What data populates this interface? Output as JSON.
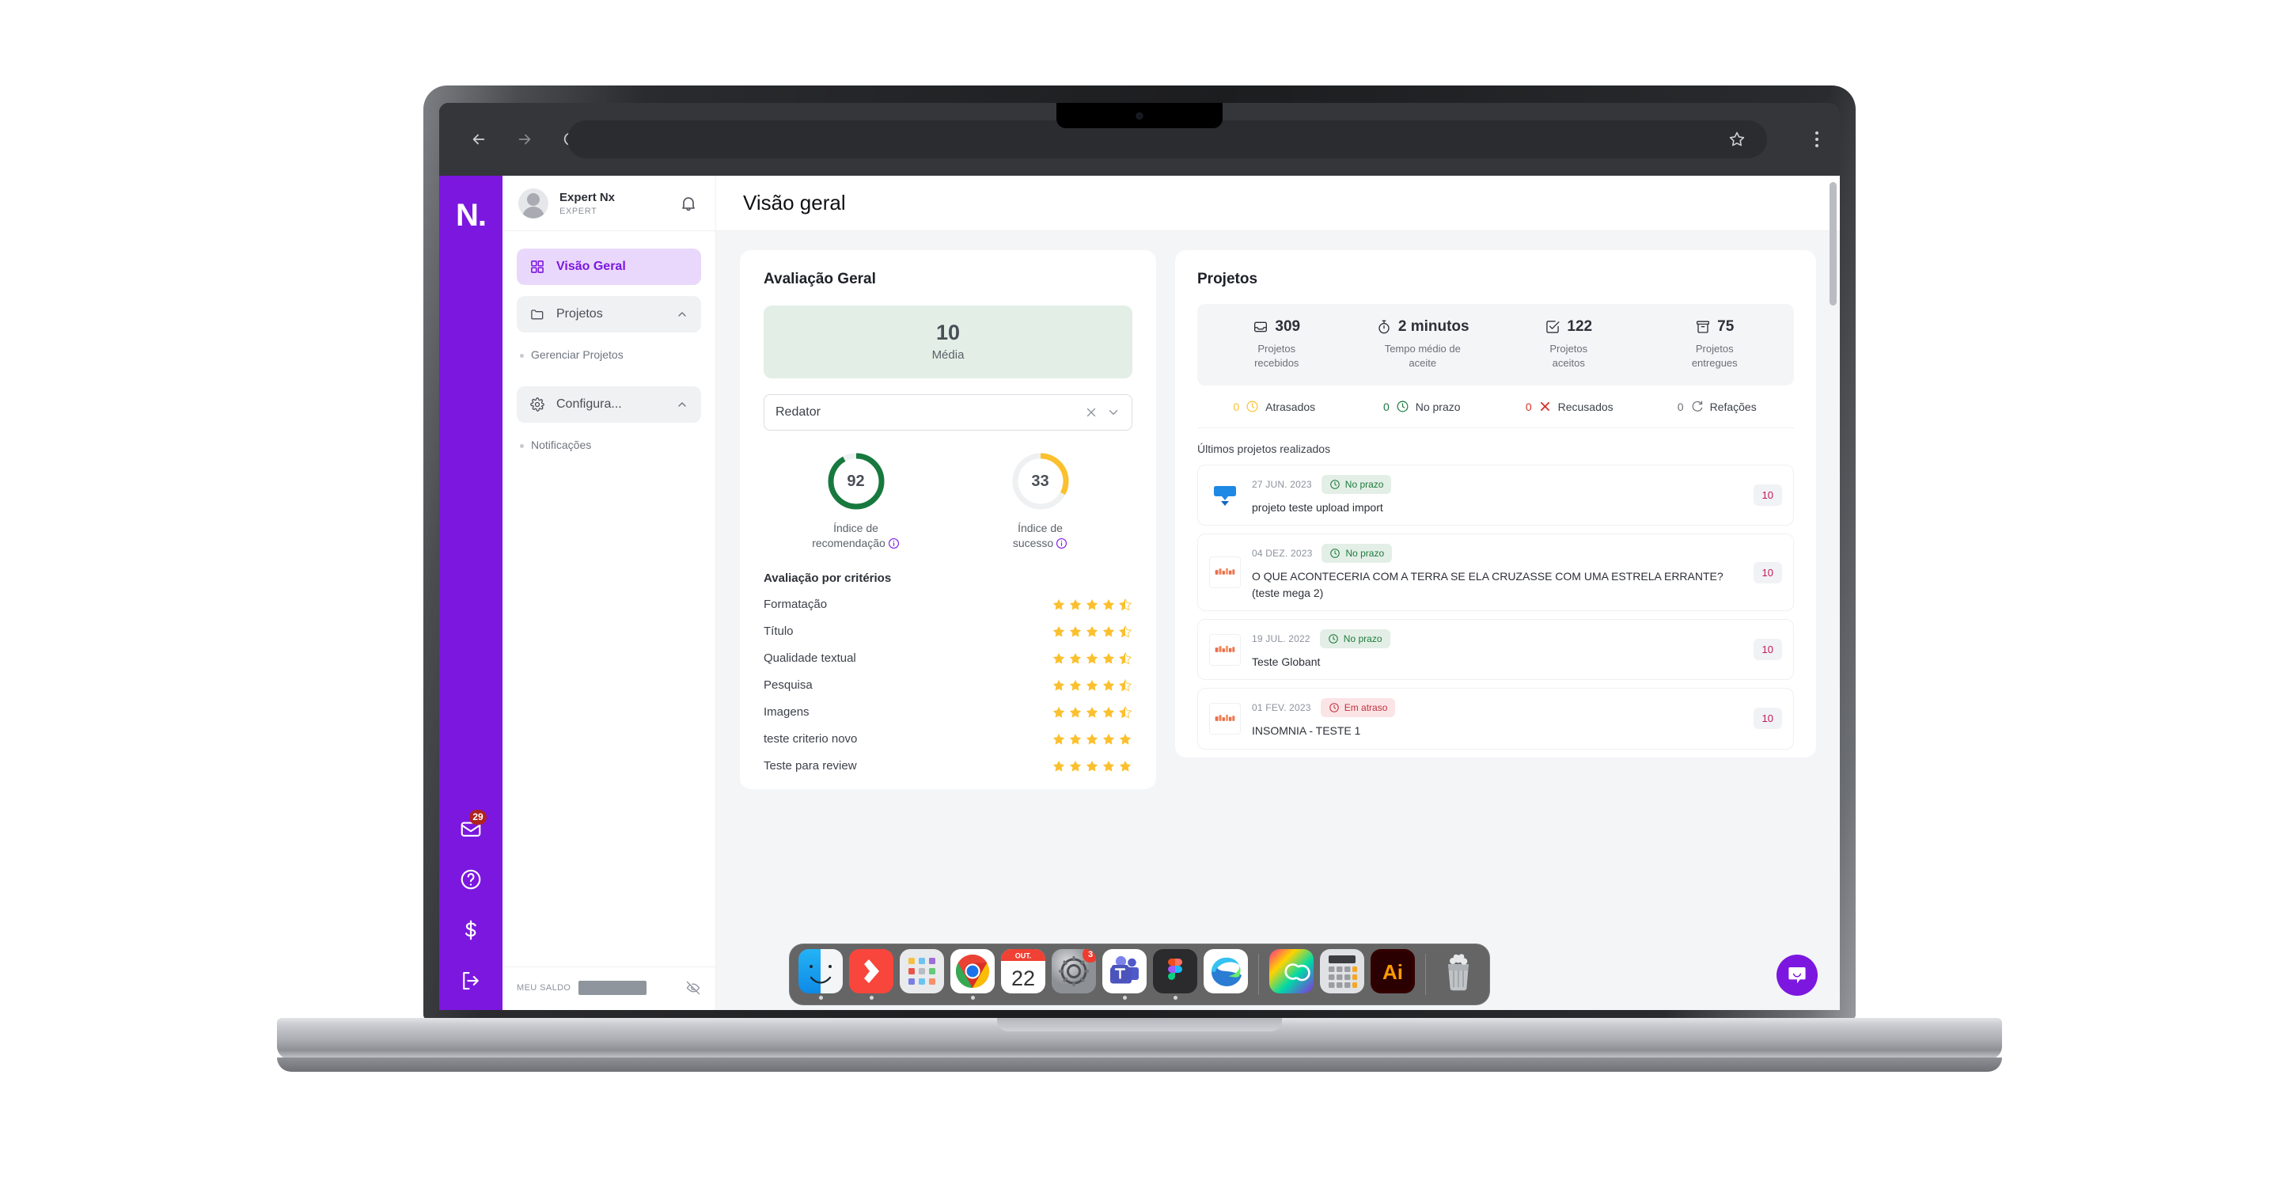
{
  "browser": {
    "back_icon": "arrow-left-icon",
    "forward_icon": "arrow-right-icon",
    "reload_icon": "reload-icon",
    "url_value": "",
    "url_placeholder": "",
    "bookmark_icon": "star-icon",
    "menu_icon": "kebab-menu-icon"
  },
  "rail": {
    "logo": "N.",
    "icons": [
      {
        "name": "mail-icon",
        "badge": "29"
      },
      {
        "name": "help-icon",
        "badge": ""
      },
      {
        "name": "dollar-icon",
        "badge": ""
      },
      {
        "name": "logout-icon",
        "badge": ""
      }
    ]
  },
  "sidebar": {
    "user": {
      "name": "Expert Nx",
      "role": "EXPERT"
    },
    "bell_icon": "bell-icon",
    "items": [
      {
        "label": "Visão Geral",
        "icon": "grid-icon",
        "type": "active"
      },
      {
        "label": "Projetos",
        "icon": "folder-icon",
        "type": "group"
      },
      {
        "label": "Gerenciar Projetos",
        "icon": "",
        "type": "sub"
      },
      {
        "label": "Configura...",
        "icon": "gear-icon",
        "type": "group"
      },
      {
        "label": "Notificações",
        "icon": "",
        "type": "sub"
      }
    ],
    "balance": {
      "label": "MEU SALDO",
      "value": "",
      "toggle_icon": "eye-off-icon"
    }
  },
  "header": {
    "title": "Visão geral"
  },
  "evaluation": {
    "card_title": "Avaliação Geral",
    "average_value": "10",
    "average_label": "Média",
    "role_select": {
      "value": "Redator",
      "clear_icon": "close-icon",
      "chevron_icon": "chevron-down-icon"
    },
    "gauges": [
      {
        "value": "92",
        "label_line1": "Índice de",
        "label_line2": "recomendação",
        "color": "#17793E",
        "track": "#eef0f2",
        "percent": 92
      },
      {
        "value": "33",
        "label_line1": "Índice de",
        "label_line2": "sucesso",
        "color": "#FBC02D",
        "track": "#eef0f2",
        "percent": 33
      }
    ],
    "criteria_title": "Avaliação por critérios",
    "criteria": [
      {
        "name": "Formatação",
        "rating": 4.5
      },
      {
        "name": "Título",
        "rating": 4.5
      },
      {
        "name": "Qualidade textual",
        "rating": 4.5
      },
      {
        "name": "Pesquisa",
        "rating": 4.5
      },
      {
        "name": "Imagens",
        "rating": 4.5
      },
      {
        "name": "teste criterio novo",
        "rating": 5
      },
      {
        "name": "Teste para review",
        "rating": 5
      }
    ]
  },
  "projects": {
    "card_title": "Projetos",
    "stats": [
      {
        "icon": "inbox-icon",
        "value": "309",
        "label_line1": "Projetos",
        "label_line2": "recebidos"
      },
      {
        "icon": "stopwatch-icon",
        "value": "2 minutos",
        "label_line1": "Tempo médio de",
        "label_line2": "aceite"
      },
      {
        "icon": "check-square-icon",
        "value": "122",
        "label_line1": "Projetos",
        "label_line2": "aceitos"
      },
      {
        "icon": "archive-icon",
        "value": "75",
        "label_line1": "Projetos",
        "label_line2": "entregues"
      }
    ],
    "statuses": [
      {
        "count": "0",
        "icon": "clock-icon",
        "label": "Atrasados",
        "color": "#FBC02D"
      },
      {
        "count": "0",
        "icon": "clock-icon",
        "label": "No prazo",
        "color": "#17793E"
      },
      {
        "count": "0",
        "icon": "x-icon",
        "label": "Recusados",
        "color": "#D0342C"
      },
      {
        "count": "0",
        "icon": "refresh-icon",
        "label": "Refações",
        "color": "#6b7078"
      }
    ],
    "list_title": "Últimos projetos realizados",
    "items": [
      {
        "date": "27 JUN. 2023",
        "status": "No prazo",
        "status_type": "ok",
        "name": "projeto teste upload import",
        "score": "10",
        "thumb": "blue-banner-thumb"
      },
      {
        "date": "04 DEZ. 2023",
        "status": "No prazo",
        "status_type": "ok",
        "name": "O QUE ACONTECERIA COM A TERRA SE ELA CRUZASSE COM UMA ESTRELA ERRANTE? (teste mega 2)",
        "score": "10",
        "thumb": "orange-text-thumb"
      },
      {
        "date": "19 JUL. 2022",
        "status": "No prazo",
        "status_type": "ok",
        "name": "Teste Globant",
        "score": "10",
        "thumb": "orange-text-thumb"
      },
      {
        "date": "01 FEV. 2023",
        "status": "Em atraso",
        "status_type": "late",
        "name": "INSOMNIA - TESTE 1",
        "score": "10",
        "thumb": "orange-text-thumb"
      }
    ]
  },
  "intercom": {
    "icon": "chat-bubble-icon"
  },
  "dock": {
    "apps": [
      {
        "name": "finder",
        "running": true,
        "badge": ""
      },
      {
        "name": "things",
        "running": true,
        "badge": ""
      },
      {
        "name": "launchpad",
        "running": false,
        "badge": ""
      },
      {
        "name": "chrome",
        "running": true,
        "badge": ""
      },
      {
        "name": "calendar",
        "running": false,
        "badge": "",
        "month": "OUT.",
        "day": "22"
      },
      {
        "name": "system-settings",
        "running": false,
        "badge": "3"
      },
      {
        "name": "teams",
        "running": true,
        "badge": ""
      },
      {
        "name": "figma",
        "running": true,
        "badge": ""
      },
      {
        "name": "edge",
        "running": false,
        "badge": ""
      }
    ],
    "apps2": [
      {
        "name": "creative-cloud",
        "running": false,
        "badge": ""
      },
      {
        "name": "calculator",
        "running": false,
        "badge": ""
      },
      {
        "name": "illustrator",
        "running": false,
        "badge": ""
      }
    ],
    "trash": {
      "name": "trash",
      "running": false
    }
  },
  "colors": {
    "brand_purple": "#7C17E0",
    "green": "#17793E",
    "yellow": "#FBC02D",
    "red": "#D0342C",
    "score_pink": "#C2185B"
  }
}
